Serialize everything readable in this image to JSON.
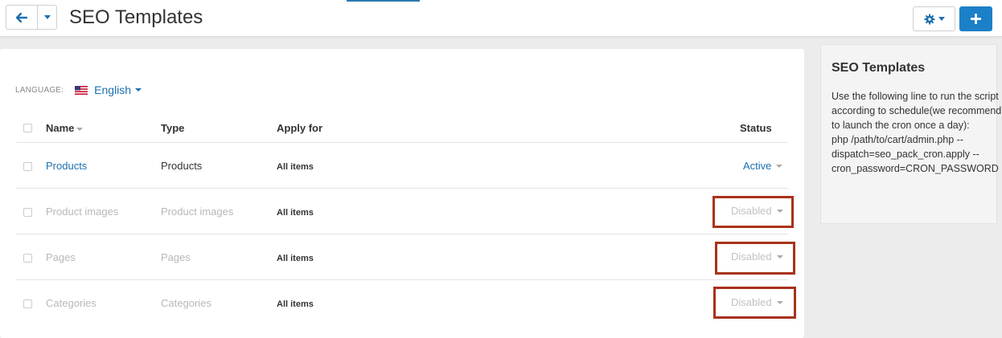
{
  "header": {
    "title": "SEO Templates"
  },
  "toolbar": {
    "back_icon": "arrow-left-icon",
    "back_menu_icon": "chevron-down-icon",
    "settings_icon": "gear-icon",
    "add_icon": "plus-icon"
  },
  "language": {
    "label": "LANGUAGE:",
    "value": "English",
    "flag_icon": "us-flag-icon"
  },
  "table": {
    "columns": {
      "name": "Name",
      "type": "Type",
      "apply_for": "Apply for",
      "status": "Status"
    },
    "rows": [
      {
        "name": "Products",
        "type": "Products",
        "apply_for": "All items",
        "status": "Active",
        "enabled": true
      },
      {
        "name": "Product images",
        "type": "Product images",
        "apply_for": "All items",
        "status": "Disabled",
        "enabled": false
      },
      {
        "name": "Pages",
        "type": "Pages",
        "apply_for": "All items",
        "status": "Disabled",
        "enabled": false
      },
      {
        "name": "Categories",
        "type": "Categories",
        "apply_for": "All items",
        "status": "Disabled",
        "enabled": false
      }
    ]
  },
  "sidebar": {
    "title": "SEO Templates",
    "description": "Use the following line to run the script according to schedule(we recommend to launch the cron once a day):",
    "command": "php /path/to/cart/admin.php --dispatch=seo_pack_cron.apply --cron_password=CRON_PASSWORD"
  },
  "colors": {
    "accent": "#1c70b0",
    "primary_button": "#1c80c8",
    "highlight_box": "#a8321a",
    "disabled_text": "#b8b8b8"
  }
}
